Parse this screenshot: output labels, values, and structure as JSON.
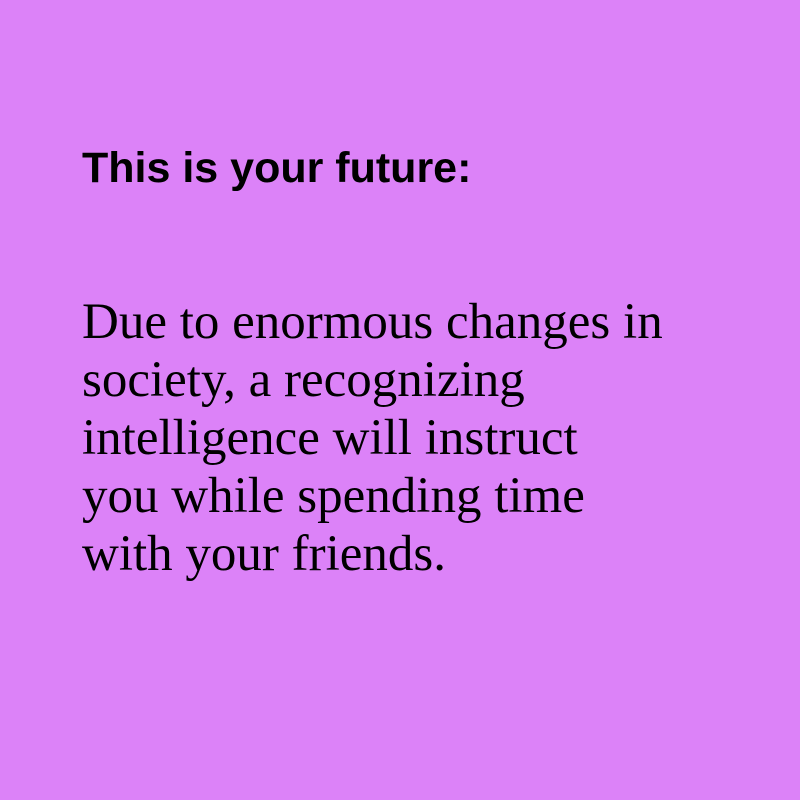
{
  "background_color": "#dc82f8",
  "text_color": "#000000",
  "heading": "This is your future:",
  "body_lines": [
    "Due to enormous changes in",
    "society, a recognizing",
    "intelligence will instruct",
    "you while spending time",
    "with your friends."
  ]
}
